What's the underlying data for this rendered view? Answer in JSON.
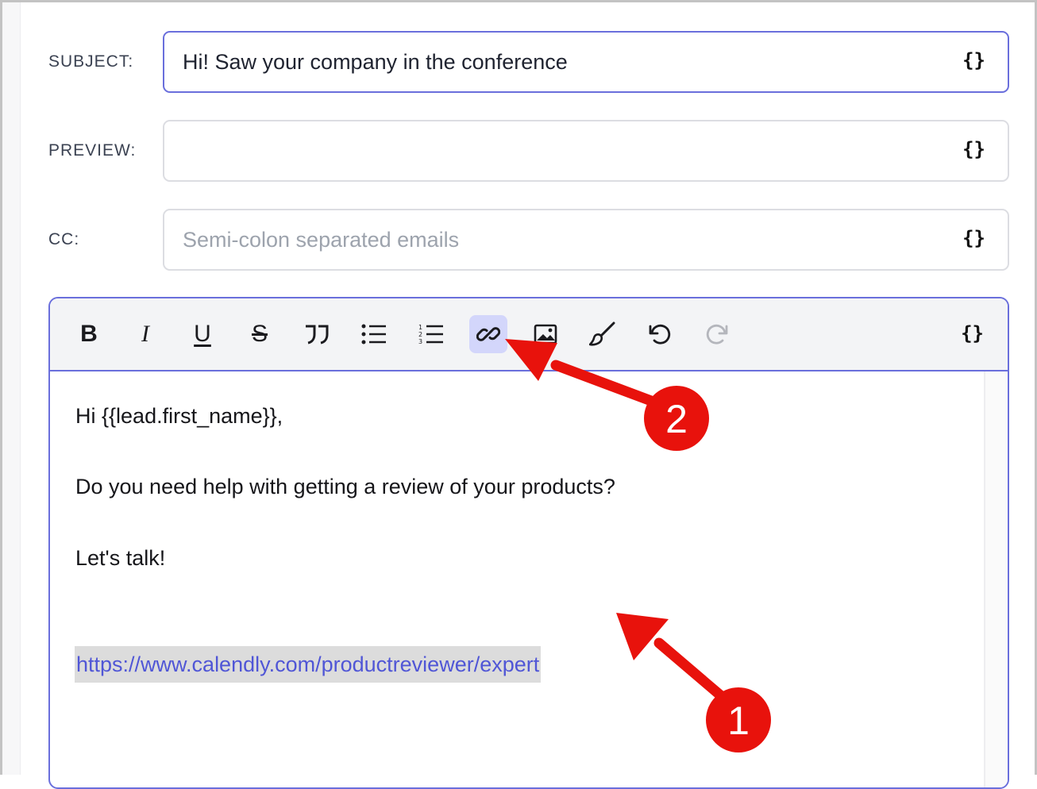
{
  "fields": {
    "subject": {
      "label": "SUBJECT:",
      "value": "Hi! Saw your company in the conference"
    },
    "preview": {
      "label": "PREVIEW:",
      "value": ""
    },
    "cc": {
      "label": "CC:",
      "value": "",
      "placeholder": "Semi-colon separated emails"
    }
  },
  "variable_icon": "{}",
  "toolbar": {
    "buttons": [
      {
        "name": "bold",
        "glyph": "B",
        "icon": "bold-icon"
      },
      {
        "name": "italic",
        "glyph": "I",
        "icon": "italic-icon"
      },
      {
        "name": "underline",
        "glyph": "U",
        "icon": "underline-icon"
      },
      {
        "name": "strikethrough",
        "glyph": "S",
        "icon": "strikethrough-icon"
      },
      {
        "name": "quote",
        "icon": "quote-icon"
      },
      {
        "name": "bullet-list",
        "icon": "bullet-list-icon"
      },
      {
        "name": "numbered-list",
        "icon": "numbered-list-icon"
      },
      {
        "name": "link",
        "icon": "link-icon",
        "state": "active"
      },
      {
        "name": "image",
        "icon": "image-icon"
      },
      {
        "name": "brush",
        "icon": "brush-icon"
      },
      {
        "name": "undo",
        "icon": "undo-icon"
      },
      {
        "name": "redo",
        "icon": "redo-icon",
        "state": "disabled"
      }
    ]
  },
  "body": {
    "greeting": "Hi {{lead.first_name}},",
    "question": "Do you need help with getting a review of your products?",
    "cta": "Let's talk!",
    "link": "https://www.calendly.com/productreviewer/expert"
  },
  "callouts": [
    {
      "number": "1",
      "target": "selected link text"
    },
    {
      "number": "2",
      "target": "link button"
    }
  ],
  "colors": {
    "accent": "#6a6fdc",
    "link": "#5056d6",
    "selection": "#dcdcdc",
    "active_button": "#d3d6fb",
    "callout": "#e8120c"
  }
}
